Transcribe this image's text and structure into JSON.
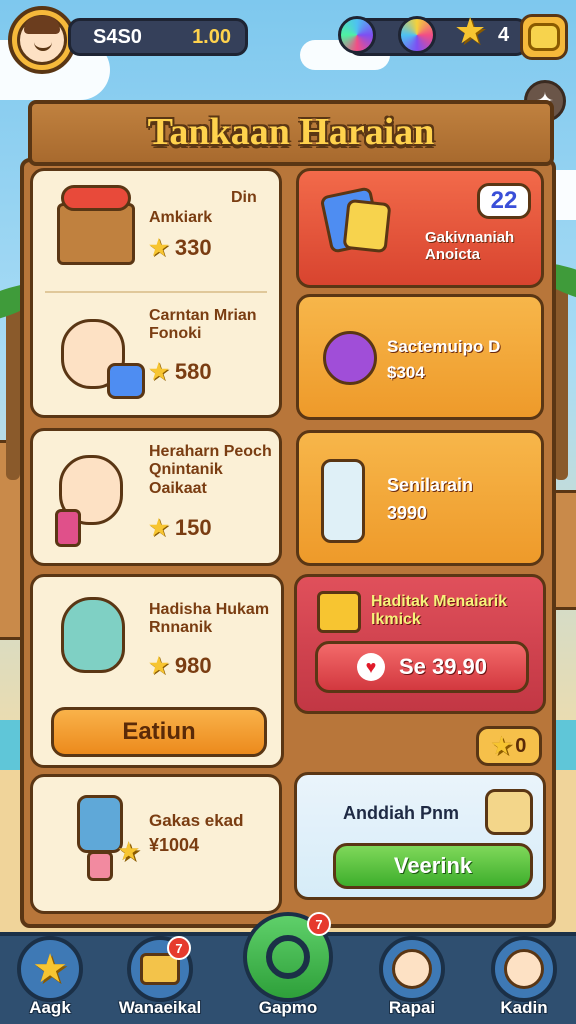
{
  "header": {
    "player_id": "S4S0",
    "balance": "1.00",
    "star_count": "4"
  },
  "title": "Tankaan Haraian",
  "left_cards": [
    {
      "tag": "Din",
      "name": "Amkiark",
      "price": "330"
    },
    {
      "name": "Carntan Mrian Fonoki",
      "price": "580"
    },
    {
      "name": "Heraharn Peoch Qnintanik Oaikaat",
      "price": "150"
    },
    {
      "name": "Hadisha Hukam Rnnanik",
      "price": "980",
      "button": "Eatiun"
    },
    {
      "name": "Gakas ekad",
      "price": "1004"
    }
  ],
  "right_cards": [
    {
      "name": "Gakivnaniah Anoicta",
      "badge": "22"
    },
    {
      "name": "Sactemuipo D",
      "price": "$304"
    },
    {
      "name": "Senilarain",
      "price": "3990"
    },
    {
      "name": "Haditak Menaiarik Ikmick",
      "button": "Se 39.90"
    },
    {
      "star_value": "0"
    },
    {
      "name": "Anddiah Pnm",
      "button": "Veerink"
    }
  ],
  "nav": [
    {
      "label": "Aagk",
      "icon": "star-icon"
    },
    {
      "label": "Wanaeikal",
      "icon": "chest-icon",
      "notif": "7"
    },
    {
      "label": "Gapmo",
      "icon": "controller-icon",
      "notif": "7"
    },
    {
      "label": "Rapai",
      "icon": "girl-avatar-icon"
    },
    {
      "label": "Kadin",
      "icon": "boy-avatar-icon"
    }
  ],
  "colors": {
    "accent": "#f6b93b",
    "wood": "#b8763a",
    "outline": "#5a3614",
    "nav": "#2f4f70"
  }
}
